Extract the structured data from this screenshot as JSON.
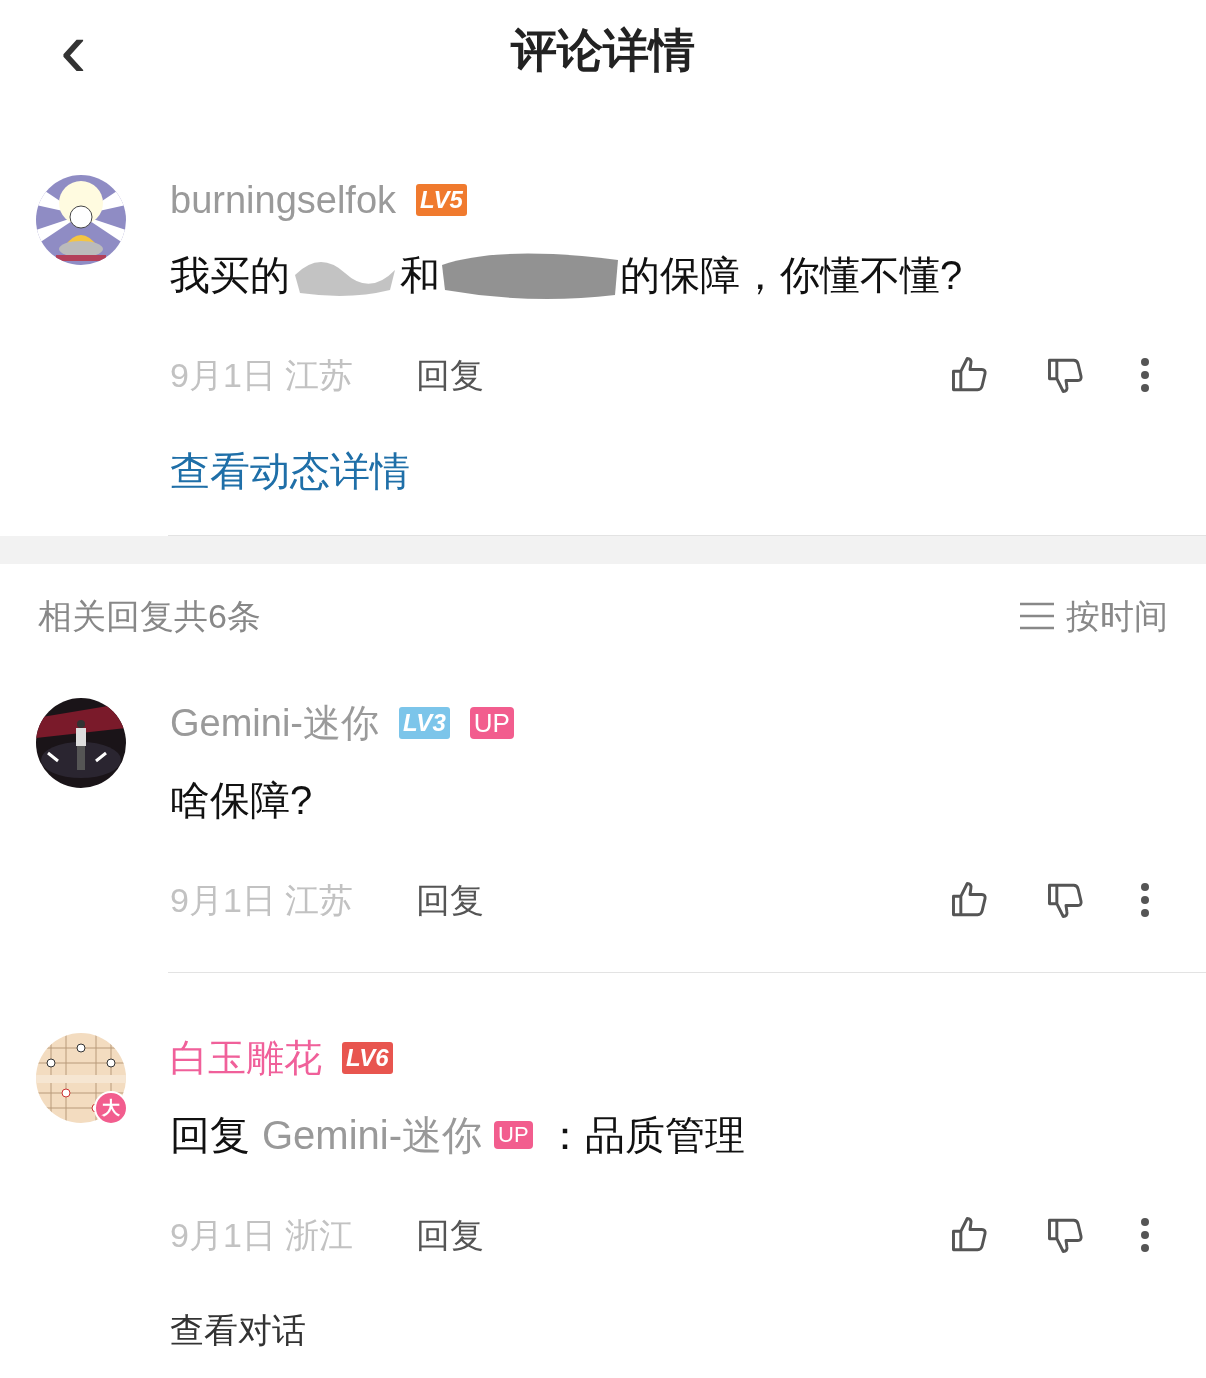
{
  "header": {
    "back_icon": "‹",
    "title": "评论详情"
  },
  "comment": {
    "username": "burningselfok",
    "color": "#9a9a9a",
    "level": {
      "text": "LV5",
      "color": "#f07a2e"
    },
    "text_parts": [
      "我买的",
      "和",
      "的保障，你懂不懂?"
    ],
    "date": "9月1日",
    "location": "江苏",
    "reply_label": "回复",
    "link": "查看动态详情"
  },
  "replies_header": {
    "count_label": "相关回复共6条",
    "sort_label": "按时间"
  },
  "replies": [
    {
      "username": "Gemini-迷你",
      "color": "#9a9a9a",
      "level": {
        "text": "LV3",
        "color": "#7cc5ea"
      },
      "up_badge": "UP",
      "text": "啥保障?",
      "date": "9月1日",
      "location": "江苏",
      "reply_label": "回复"
    },
    {
      "username": "白玉雕花",
      "color": "#f0609a",
      "level": {
        "text": "LV6",
        "color": "#e8554f"
      },
      "avatar_badge": "大",
      "reply_prefix": "回复",
      "reply_to": {
        "name": "Gemini-迷你",
        "badge": "UP"
      },
      "text": "：品质管理",
      "date": "9月1日",
      "location": "浙江",
      "reply_label": "回复",
      "conversation_link": "查看对话"
    }
  ]
}
